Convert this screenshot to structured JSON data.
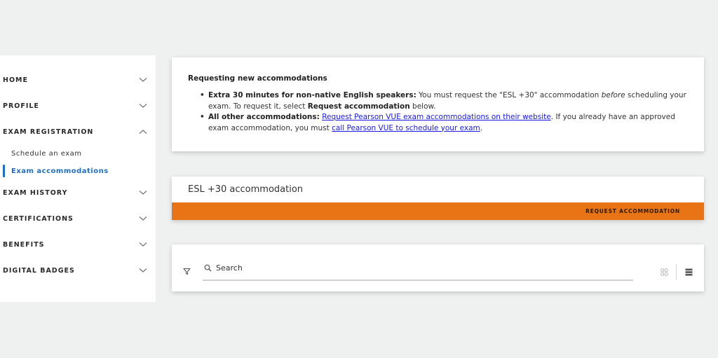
{
  "sidebar": {
    "items": [
      {
        "label": "HOME",
        "expanded": false
      },
      {
        "label": "PROFILE",
        "expanded": false
      },
      {
        "label": "EXAM REGISTRATION",
        "expanded": true,
        "children": [
          {
            "label": "Schedule an exam",
            "active": false
          },
          {
            "label": "Exam accommodations",
            "active": true
          }
        ]
      },
      {
        "label": "EXAM HISTORY",
        "expanded": false
      },
      {
        "label": "CERTIFICATIONS",
        "expanded": false
      },
      {
        "label": "BENEFITS",
        "expanded": false
      },
      {
        "label": "DIGITAL BADGES",
        "expanded": false
      }
    ]
  },
  "info_card": {
    "title": "Requesting new accommodations",
    "bullet1": {
      "bold": "Extra 30 minutes for non-native English speakers:",
      "text1": " You must request the \"ESL +30\" accommodation ",
      "italic": "before",
      "text2": " scheduling your exam. To request it, select ",
      "bold2": "Request accommodation",
      "text3": " below."
    },
    "bullet2": {
      "bold": "All other accommodations:",
      "link1": "Request Pearson VUE exam accommodations on their website",
      "text1": ". If you already have an approved exam accommodation, you must ",
      "link2": "call Pearson VUE to schedule your exam",
      "text2": "."
    }
  },
  "accommodation_card": {
    "title": "ESL +30 accommodation",
    "button_label": "REQUEST ACCOMMODATION"
  },
  "search_card": {
    "search_placeholder": "Search",
    "search_value": ""
  },
  "colors": {
    "accent_blue": "#1f6fc4",
    "orange": "#e97415",
    "link": "#1a1ae6",
    "background": "#eff0f0"
  }
}
